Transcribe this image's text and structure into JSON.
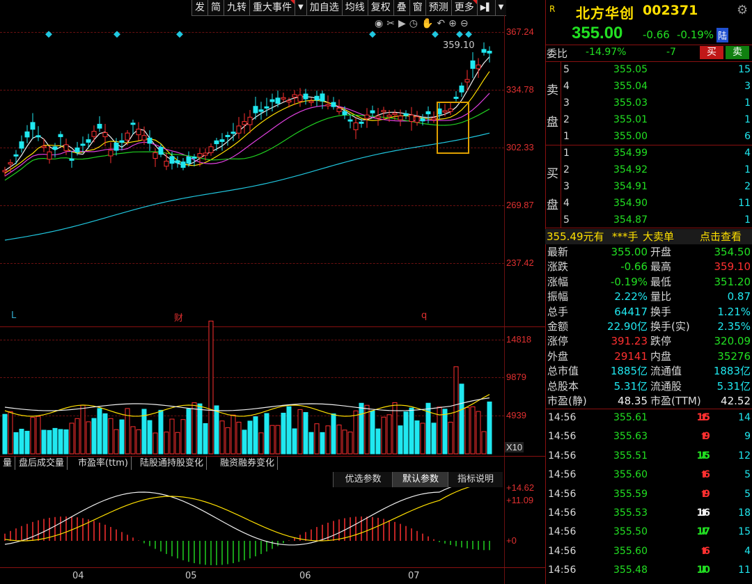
{
  "toolbar": [
    "发",
    "简",
    "九转",
    "重大事件",
    "加自选",
    "均线",
    "复权",
    "叠",
    "窗",
    "预测",
    "更多"
  ],
  "price_axis": [
    "367.24",
    "334.78",
    "302.33",
    "269.87",
    "237.42"
  ],
  "high_marker": "359.10",
  "markers": {
    "left": "L",
    "mid": "财",
    "right": "q"
  },
  "vol_axis": [
    "14818",
    "9879",
    "4939",
    "X10"
  ],
  "ind_tabs": [
    "量",
    "盘后成交量",
    "市盈率(ttm)",
    "陆股通持股变化",
    "融资融券变化"
  ],
  "ind_buttons": [
    "优选参数",
    "默认参数",
    "指标说明"
  ],
  "macd_axis": [
    "+14.62",
    "+11.09",
    "+0"
  ],
  "months": [
    "04",
    "05",
    "06",
    "07"
  ],
  "stock": {
    "tag": "R",
    "name": "北方华创",
    "code": "002371",
    "price": "355.00",
    "change": "-0.66",
    "pct": "-0.19%",
    "lu": "陆"
  },
  "weibi": {
    "label": "委比",
    "pct": "-14.97%",
    "diff": "-7",
    "buy": "买",
    "sell": "卖"
  },
  "sell_label": [
    "卖",
    "盘"
  ],
  "buy_label": [
    "买",
    "盘"
  ],
  "asks": [
    {
      "n": "5",
      "p": "355.05",
      "v": "15"
    },
    {
      "n": "4",
      "p": "355.04",
      "v": "3"
    },
    {
      "n": "3",
      "p": "355.03",
      "v": "1"
    },
    {
      "n": "2",
      "p": "355.01",
      "v": "1"
    },
    {
      "n": "1",
      "p": "355.00",
      "v": "6"
    }
  ],
  "bids": [
    {
      "n": "1",
      "p": "354.99",
      "v": "4"
    },
    {
      "n": "2",
      "p": "354.92",
      "v": "1"
    },
    {
      "n": "3",
      "p": "354.91",
      "v": "2"
    },
    {
      "n": "4",
      "p": "354.90",
      "v": "11"
    },
    {
      "n": "5",
      "p": "354.87",
      "v": "1"
    }
  ],
  "bigorder": {
    "a": "355.49元有",
    "b": "***手",
    "c": "大卖单",
    "d": "点击查看"
  },
  "stats": [
    {
      "l1": "最新",
      "v1": "355.00",
      "c1": "green",
      "l2": "开盘",
      "v2": "354.50",
      "c2": "green"
    },
    {
      "l1": "涨跌",
      "v1": "-0.66",
      "c1": "green",
      "l2": "最高",
      "v2": "359.10",
      "c2": "red"
    },
    {
      "l1": "涨幅",
      "v1": "-0.19%",
      "c1": "green",
      "l2": "最低",
      "v2": "351.20",
      "c2": "green"
    },
    {
      "l1": "振幅",
      "v1": "2.22%",
      "c1": "cyan",
      "l2": "量比",
      "v2": "0.87",
      "c2": "cyan"
    },
    {
      "l1": "总手",
      "v1": "64417",
      "c1": "cyan",
      "l2": "换手",
      "v2": "1.21%",
      "c2": "cyan"
    },
    {
      "l1": "金额",
      "v1": "22.90亿",
      "c1": "cyan",
      "l2": "换手(实)",
      "v2": "2.35%",
      "c2": "cyan"
    },
    {
      "l1": "涨停",
      "v1": "391.23",
      "c1": "red",
      "l2": "跌停",
      "v2": "320.09",
      "c2": "green"
    },
    {
      "l1": "外盘",
      "v1": "29141",
      "c1": "red",
      "l2": "内盘",
      "v2": "35276",
      "c2": "green"
    },
    {
      "l1": "总市值",
      "v1": "1885亿",
      "c1": "cyan",
      "l2": "流通值",
      "v2": "1883亿",
      "c2": "cyan"
    },
    {
      "l1": "总股本",
      "v1": "5.31亿",
      "c1": "cyan",
      "l2": "流通股",
      "v2": "5.31亿",
      "c2": "cyan"
    },
    {
      "l1": "市盈(静)",
      "v1": "48.35",
      "c1": "white",
      "l2": "市盈(TTM)",
      "v2": "42.52",
      "c2": "white"
    }
  ],
  "ticks": [
    {
      "t": "14:56",
      "p": "355.61",
      "v": "15",
      "dir": "up",
      "c": "red",
      "n": "14"
    },
    {
      "t": "14:56",
      "p": "355.63",
      "v": "9",
      "dir": "up",
      "c": "red",
      "n": "9"
    },
    {
      "t": "14:56",
      "p": "355.51",
      "v": "15",
      "dir": "down",
      "c": "green",
      "n": "12"
    },
    {
      "t": "14:56",
      "p": "355.60",
      "v": "6",
      "dir": "up",
      "c": "red",
      "n": "5"
    },
    {
      "t": "14:56",
      "p": "355.59",
      "v": "9",
      "dir": "up",
      "c": "red",
      "n": "5"
    },
    {
      "t": "14:56",
      "p": "355.53",
      "v": "16",
      "dir": "up",
      "c": "white",
      "n": "18"
    },
    {
      "t": "14:56",
      "p": "355.50",
      "v": "17",
      "dir": "down",
      "c": "green",
      "n": "15"
    },
    {
      "t": "14:56",
      "p": "355.60",
      "v": "6",
      "dir": "up",
      "c": "red",
      "n": "4"
    },
    {
      "t": "14:56",
      "p": "355.48",
      "v": "10",
      "dir": "down",
      "c": "green",
      "n": "11"
    }
  ]
}
